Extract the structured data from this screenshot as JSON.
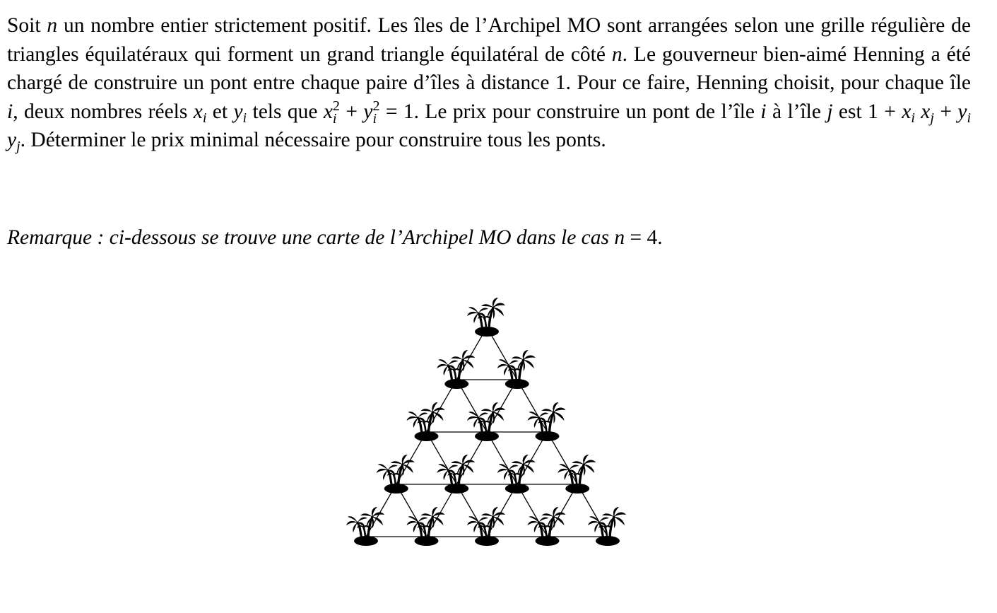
{
  "problem": {
    "s1a": "Soit ",
    "n": "n",
    "s1b": " un nombre entier strictement positif. Les îles de l’Archipel MO sont arrangées selon une grille régulière de triangles équilatéraux qui forment un grand triangle équilatéral de côté ",
    "s1c": ". Le gouverneur bien-aimé Henning a été chargé de construire un pont entre chaque paire d’îles à distance 1. Pour ce faire, Henning choisit, pour chaque île ",
    "i": "i",
    "s1d": ", deux nombres réels ",
    "x": "x",
    "y": "y",
    "sub_i": "i",
    "sub_j": "j",
    "sup_2": "2",
    "s1e": " et ",
    "s1f": " tels que ",
    "plus": " + ",
    "eq_one": " = 1",
    "s1g": ". Le prix pour construire un pont de l’île ",
    "s1h": " à l’île ",
    "j": "j",
    "s1i": " est 1 + ",
    "s1j": ". Déterminer le prix minimal nécessaire pour construire tous les ponts."
  },
  "remark": {
    "label": "Remarque : ci-dessous se trouve une carte de l’Archipel MO dans le cas ",
    "n": "n",
    "eq": " = 4",
    "end": "."
  },
  "map": {
    "side": 4,
    "island_icon": "palm-island-icon",
    "color": "#000000"
  }
}
